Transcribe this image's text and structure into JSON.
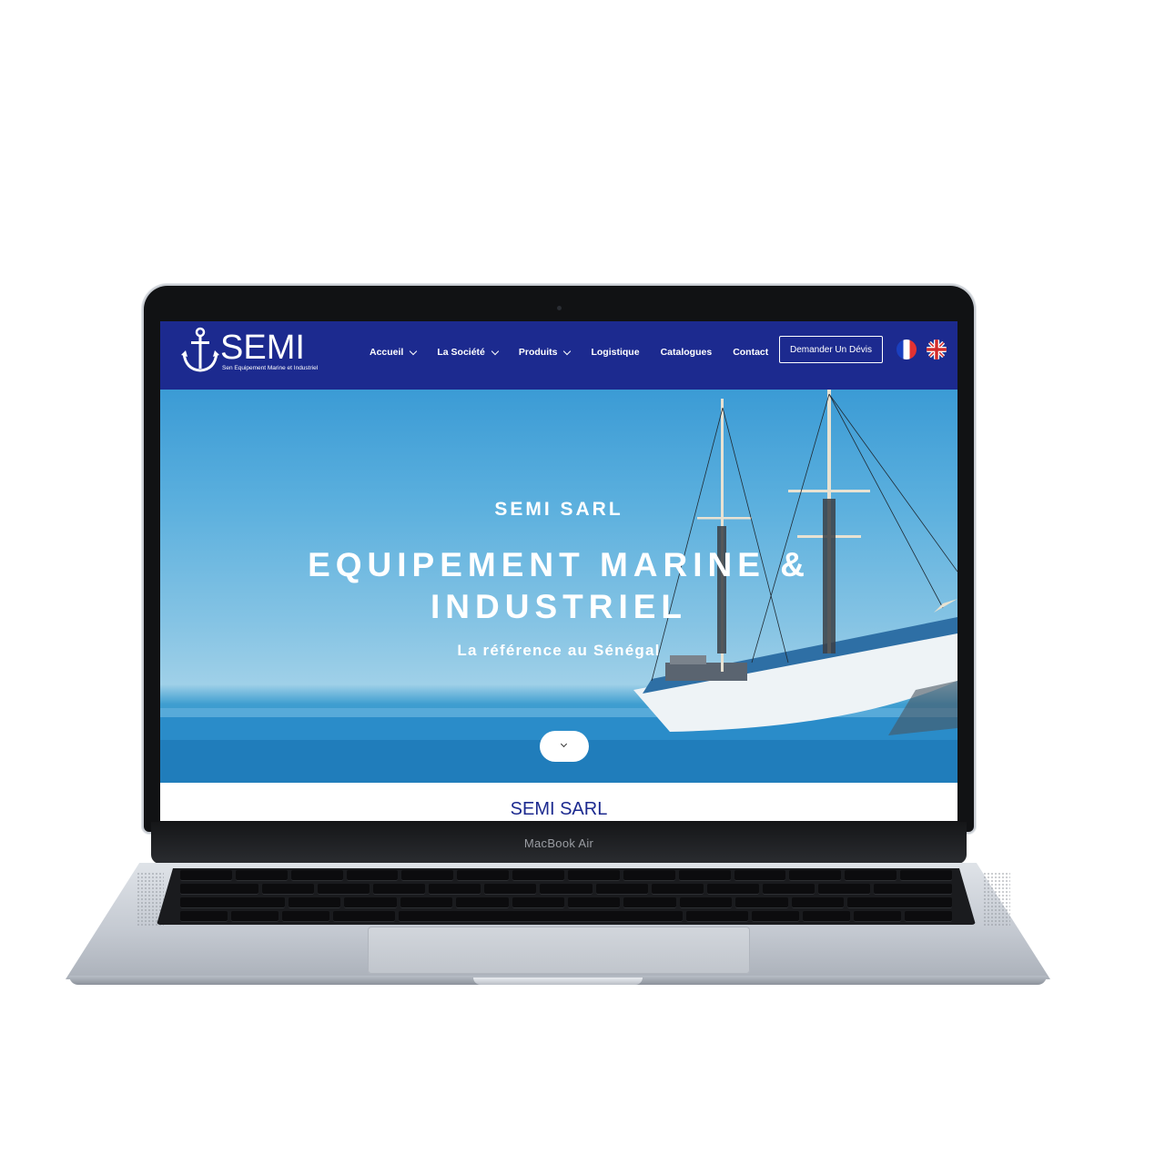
{
  "device": {
    "label": "MacBook Air"
  },
  "header": {
    "logo": {
      "name": "SEMI",
      "subtitle": "Sen Equipement Marine et Industriel"
    },
    "nav": [
      {
        "label": "Accueil",
        "has_dropdown": true
      },
      {
        "label": "La Société",
        "has_dropdown": true
      },
      {
        "label": "Produits",
        "has_dropdown": true
      },
      {
        "label": "Logistique",
        "has_dropdown": false
      },
      {
        "label": "Catalogues",
        "has_dropdown": false
      },
      {
        "label": "Contact",
        "has_dropdown": false
      }
    ],
    "cta_label": "Demander Un Dévis",
    "languages": [
      "fr",
      "en"
    ]
  },
  "hero": {
    "kicker": "SEMI SARL",
    "title_line1": "EQUIPEMENT MARINE &",
    "title_line2": "INDUSTRIEL",
    "tagline": "La référence au Sénégal"
  },
  "section": {
    "heading": "SEMI SARL"
  },
  "colors": {
    "brand": "#1c2a8f",
    "hero_sky": "#5cb0de",
    "white": "#ffffff"
  }
}
